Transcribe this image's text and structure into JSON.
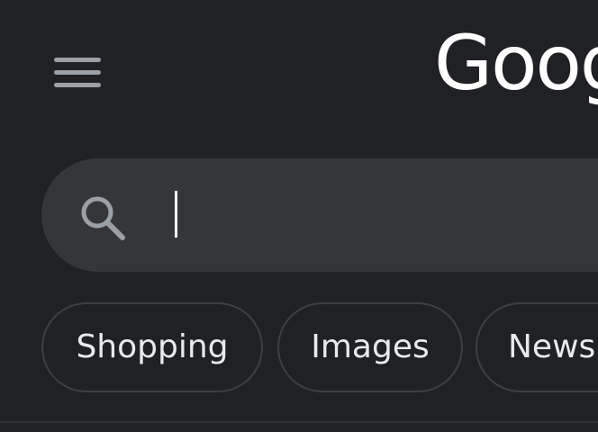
{
  "header": {
    "menu_icon": "hamburger-menu-icon",
    "logo_text": "Goog"
  },
  "search": {
    "icon": "search-icon",
    "value": "",
    "placeholder": ""
  },
  "chips": [
    {
      "label": "Shopping"
    },
    {
      "label": "Images"
    },
    {
      "label": "News"
    }
  ],
  "colors": {
    "background": "#202124",
    "search_bar": "#35363a",
    "chip_border": "#3c4043",
    "text": "#e8eaed",
    "icon": "#9aa0a6"
  }
}
